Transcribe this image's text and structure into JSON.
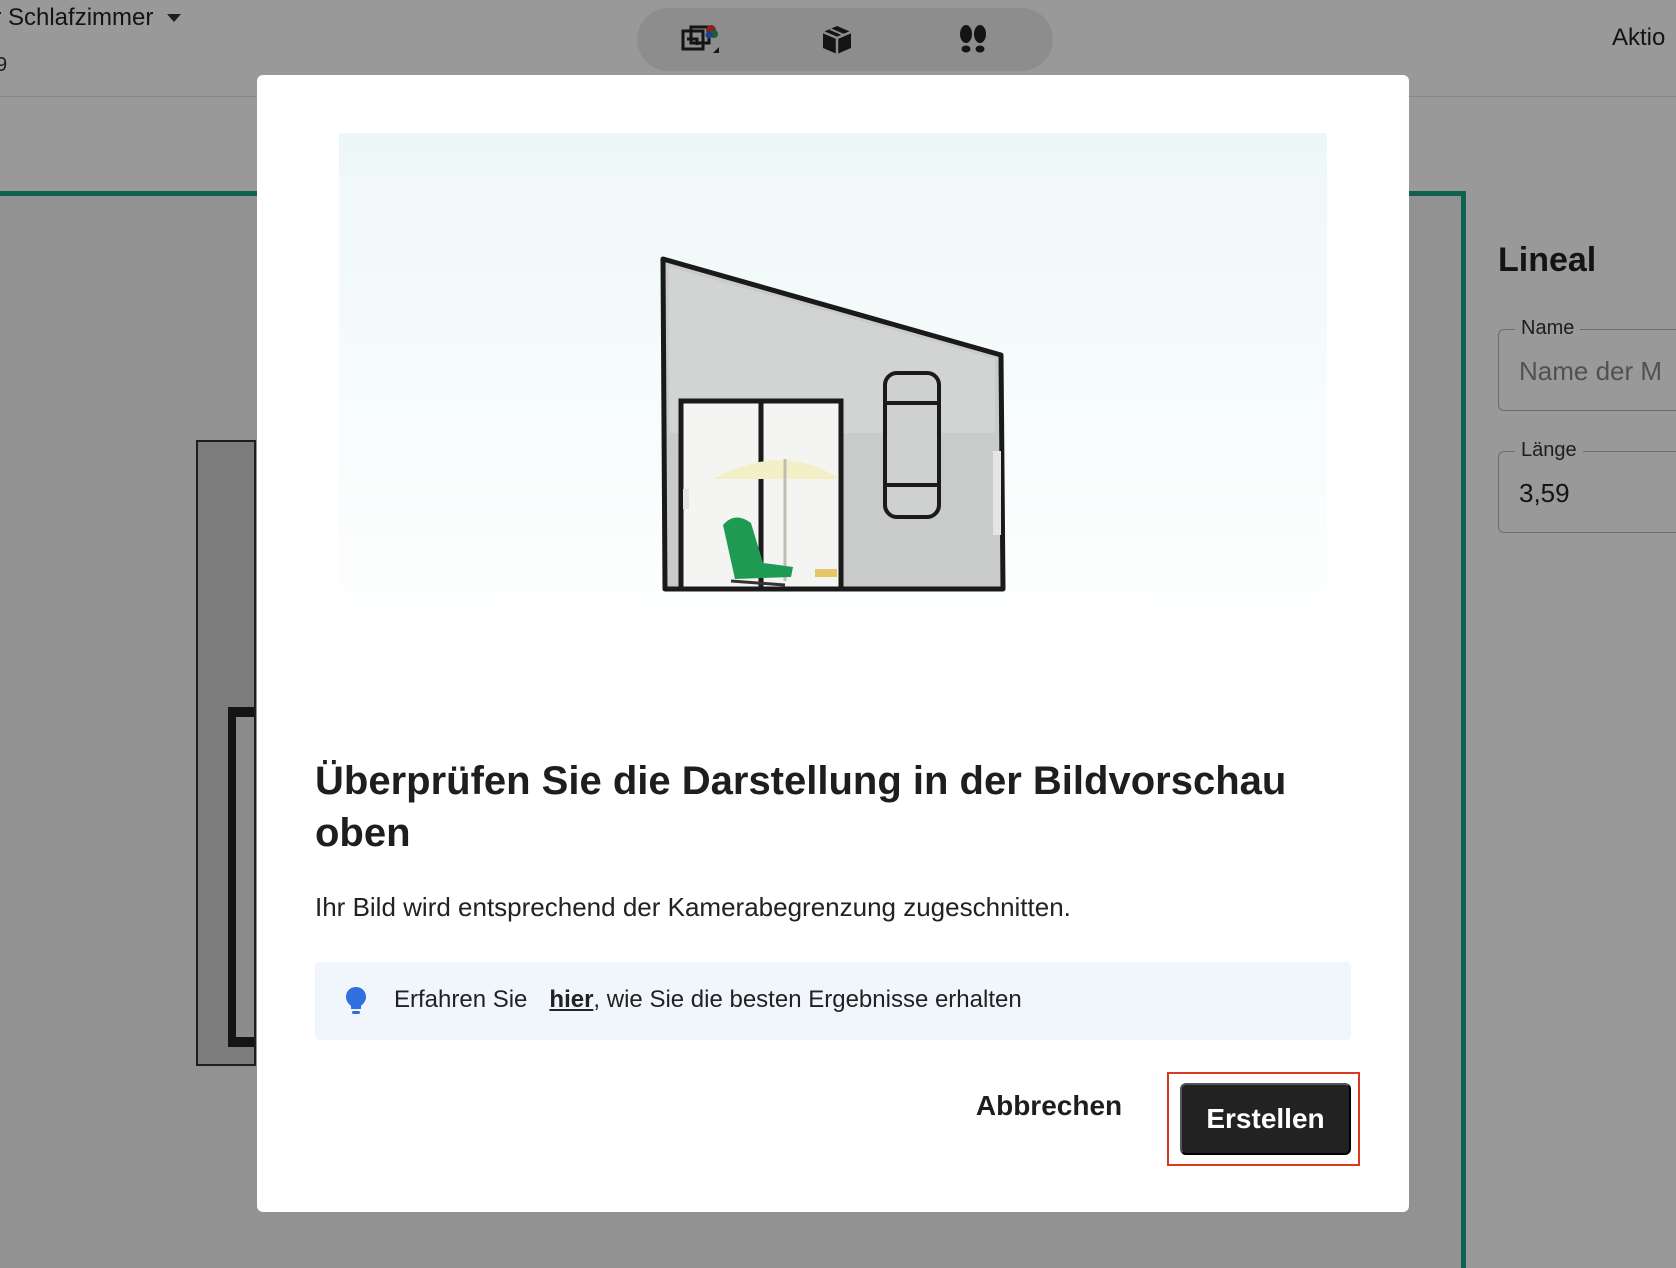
{
  "header": {
    "project_title": "ir Schlafzimmer",
    "project_subtitle": "9",
    "actions_label": "Aktio"
  },
  "toolbar": {
    "buttons": [
      {
        "icon": "floorplan-2d-3d-icon"
      },
      {
        "icon": "3d-box-icon"
      },
      {
        "icon": "footprints-icon"
      }
    ]
  },
  "side_panel": {
    "title": "Lineal",
    "name_field": {
      "label": "Name",
      "placeholder": "Name der M"
    },
    "length_field": {
      "label": "Länge",
      "value": "3,59"
    }
  },
  "dialog": {
    "heading": "Überprüfen Sie die Darstellung in der Bildvorschau oben",
    "body": "Ihr Bild wird entsprechend der Kamerabegrenzung zugeschnitten.",
    "info": {
      "prefix": "Erfahren Sie",
      "link": "hier",
      "suffix": ", wie Sie die besten Ergebnisse erhalten"
    },
    "cancel_label": "Abbrechen",
    "create_label": "Erstellen"
  },
  "colors": {
    "accent_green": "#1aa383",
    "primary_button": "#222222",
    "highlight_outline": "#d93a1f",
    "info_background": "#f1f6fc",
    "bulb_blue": "#2f6fe0"
  }
}
